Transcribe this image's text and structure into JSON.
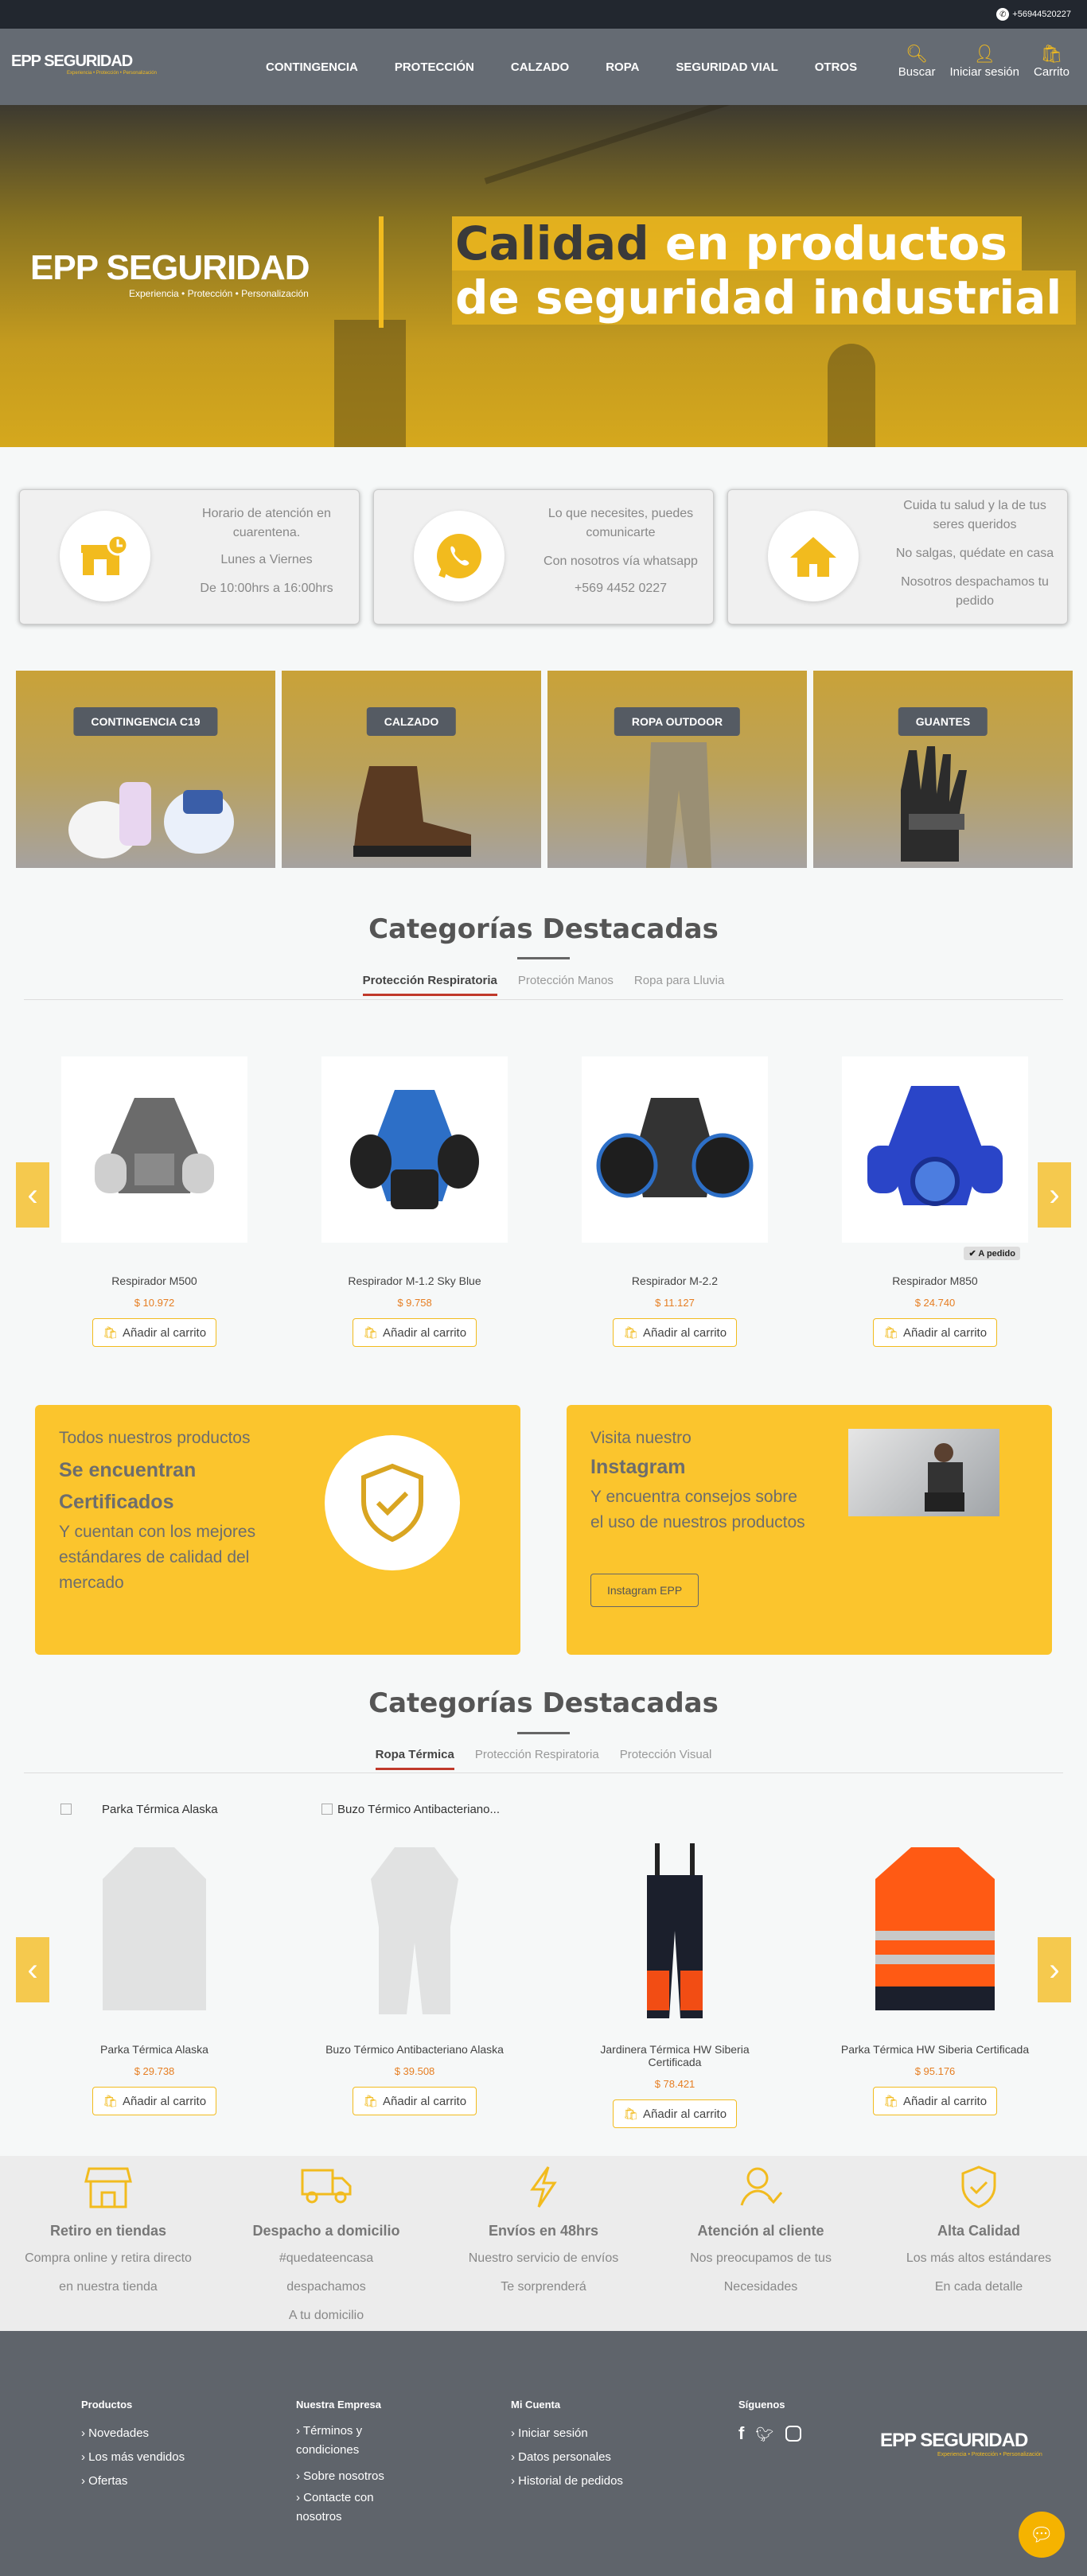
{
  "topbar": {
    "phone": "+56944520227"
  },
  "header": {
    "logo_text": "EPP SEGURIDAD",
    "logo_tagline": "Experiencia • Protección • Personalización",
    "nav": [
      "CONTINGENCIA",
      "PROTECCIÓN",
      "CALZADO",
      "ROPA",
      "SEGURIDAD VIAL",
      "OTROS"
    ],
    "actions": {
      "search": "Buscar",
      "login": "Iniciar sesión",
      "cart": "Carrito"
    }
  },
  "hero": {
    "logo_text": "EPP SEGURIDAD",
    "logo_tagline": "Experiencia • Protección • Personalización",
    "line1_a": "Calidad",
    "line1_b": " en productos",
    "line2": "de seguridad industrial"
  },
  "info": [
    {
      "lines": [
        "Horario de atención en cuarentena.",
        "Lunes a Viernes",
        "De 10:00hrs a 16:00hrs"
      ],
      "icon": "store-clock-icon"
    },
    {
      "lines": [
        "Lo que necesites, puedes comunicarte",
        "Con nosotros vía whatsapp",
        "+569 4452 0227"
      ],
      "icon": "whatsapp-icon"
    },
    {
      "lines": [
        "Cuida tu salud y la de tus seres queridos",
        "No salgas, quédate en casa",
        "Nosotros despachamos tu pedido"
      ],
      "icon": "home-icon"
    }
  ],
  "categories": [
    "CONTINGENCIA C19",
    "CALZADO",
    "ROPA OUTDOOR",
    "GUANTES"
  ],
  "featured1": {
    "title": "Categorías Destacadas",
    "tabs": [
      "Protección Respiratoria",
      "Protección Manos",
      "Ropa para Lluvia"
    ],
    "products": [
      {
        "name": "Respirador M500",
        "price": "$ 10.972",
        "badge": ""
      },
      {
        "name": "Respirador M-1.2 Sky Blue",
        "price": "$ 9.758",
        "badge": ""
      },
      {
        "name": "Respirador M-2.2",
        "price": "$ 11.127",
        "badge": ""
      },
      {
        "name": "Respirador M850",
        "price": "$ 24.740",
        "badge": "A pedido"
      }
    ],
    "cart_label": "Añadir al carrito"
  },
  "promo1": {
    "l1": "Todos nuestros productos",
    "l2": "Se encuentran",
    "l3": "Certificados",
    "l4": "Y cuentan con los mejores estándares de calidad del mercado"
  },
  "promo2": {
    "l1": "Visita nuestro",
    "l2": "Instagram",
    "l3": "Y encuentra consejos sobre el uso de nuestros productos",
    "button": "Instagram EPP"
  },
  "featured2": {
    "title": "Categorías Destacadas",
    "tabs": [
      "Ropa Térmica",
      "Protección Respiratoria",
      "Protección Visual"
    ],
    "loading_labels": [
      "Parka Térmica Alaska",
      "Buzo Térmico Antibacteriano..."
    ],
    "products": [
      {
        "name": "Parka Térmica Alaska",
        "price": "$ 29.738"
      },
      {
        "name": "Buzo Térmico Antibacteriano Alaska",
        "price": "$ 39.508"
      },
      {
        "name": "Jardinera Térmica HW Siberia Certificada",
        "price": "$ 78.421"
      },
      {
        "name": "Parka Térmica HW Siberia Certificada",
        "price": "$ 95.176"
      }
    ],
    "cart_label": "Añadir al carrito"
  },
  "features": [
    {
      "title": "Retiro en tiendas",
      "d1": "Compra online y retira directo",
      "d2": "en nuestra tienda",
      "icon": "store-icon"
    },
    {
      "title": "Despacho a domicilio",
      "d1": "#quedateencasa despachamos",
      "d2": "A tu domicilio",
      "icon": "truck-icon"
    },
    {
      "title": "Envíos en 48hrs",
      "d1": "Nuestro servicio de envíos",
      "d2": "Te sorprenderá",
      "icon": "bolt-icon"
    },
    {
      "title": "Atención al cliente",
      "d1": "Nos preocupamos de tus",
      "d2": "Necesidades",
      "icon": "support-icon"
    },
    {
      "title": "Alta Calidad",
      "d1": "Los más altos estándares",
      "d2": "En cada detalle",
      "icon": "shield-check-icon"
    }
  ],
  "footer": {
    "productos": {
      "title": "Productos",
      "items": [
        "Novedades",
        "Los más vendidos",
        "Ofertas"
      ]
    },
    "empresa": {
      "title": "Nuestra Empresa",
      "items": [
        "Términos y condiciones",
        "Sobre nosotros",
        "Contacte con nosotros"
      ]
    },
    "cuenta": {
      "title": "Mi Cuenta",
      "items": [
        "Iniciar sesión",
        "Datos personales",
        "Historial de pedidos"
      ]
    },
    "siguenos": {
      "title": "Síguenos"
    },
    "logo_text": "EPP SEGURIDAD",
    "logo_tagline": "Experiencia • Protección • Personalización"
  },
  "colors": {
    "accent": "#f2bb1e",
    "header": "#656b73",
    "footer": "#5f646b",
    "price": "#e67e22"
  }
}
